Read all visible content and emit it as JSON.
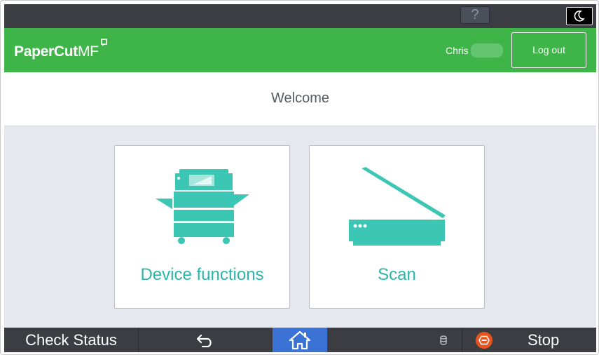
{
  "system_bar": {
    "help_label": "?"
  },
  "header": {
    "logo_part1": "PaperCut",
    "logo_part2": "MF",
    "user_name": "Chris",
    "logout_label": "Log out",
    "brand_color": "#3eb449"
  },
  "welcome": {
    "title": "Welcome"
  },
  "tiles": [
    {
      "label": "Device functions",
      "icon": "copier-icon",
      "color": "#2ab5a8"
    },
    {
      "label": "Scan",
      "icon": "scanner-icon",
      "color": "#2ab5a8"
    }
  ],
  "bottom_bar": {
    "check_status_label": "Check Status",
    "back_icon": "back-arrow-icon",
    "home_icon": "home-icon",
    "data_icon": "data-indicator-icon",
    "stop_icon": "stop-icon",
    "stop_label": "Stop",
    "home_color": "#3a72d6",
    "stop_color": "#e8541e"
  }
}
